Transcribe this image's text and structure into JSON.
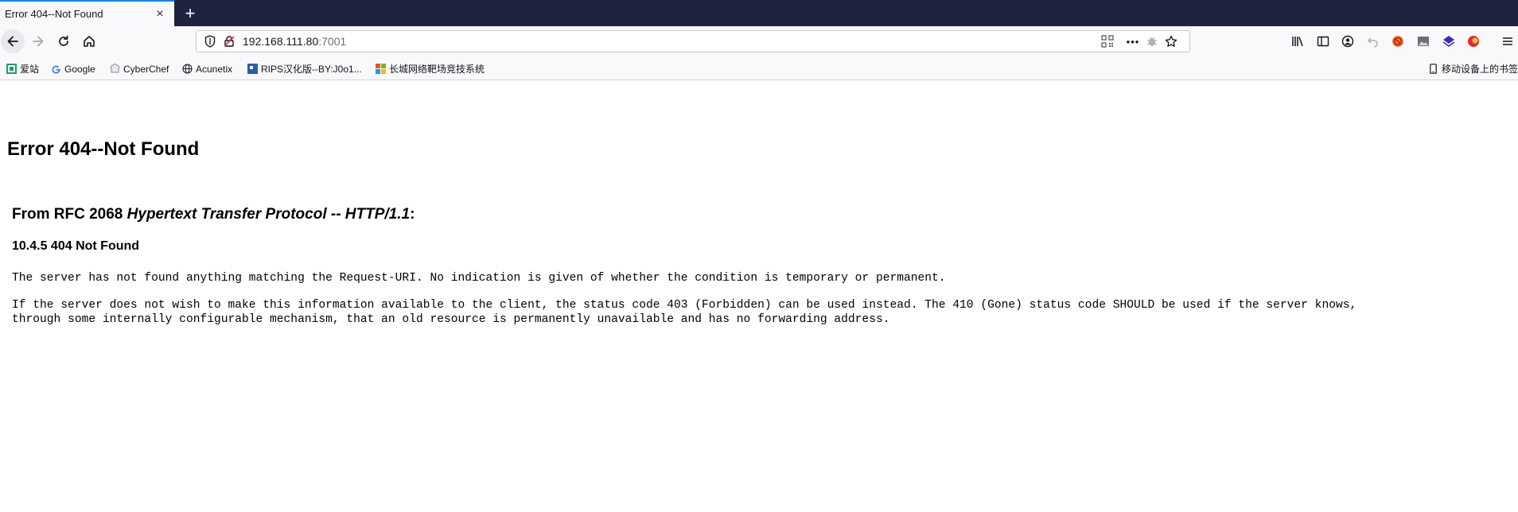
{
  "browser": {
    "tab_title": "Error 404--Not Found",
    "tab_close_symbol": "×",
    "new_tab_symbol": "+",
    "url_host": "192.168.111.80",
    "url_port": ":7001",
    "page_actions_symbol": "•••",
    "accent_color": "#0a84ff",
    "tabstrip_color": "#202340"
  },
  "bookmarks": [
    {
      "label": "爱站",
      "icon": "aizhan-icon"
    },
    {
      "label": "Google",
      "icon": "google-icon"
    },
    {
      "label": "CyberChef",
      "icon": "cyberchef-icon"
    },
    {
      "label": "Acunetix",
      "icon": "globe-icon"
    },
    {
      "label": "RIPS汉化版--BY:J0o1...",
      "icon": "rips-icon"
    },
    {
      "label": "长城网络靶场竞技系统",
      "icon": "windows-icon"
    }
  ],
  "mobile_bookmarks": "移动设备上的书签",
  "content": {
    "h1": "Error 404--Not Found",
    "h2_prefix": "From RFC 2068 ",
    "h2_italic": "Hypertext Transfer Protocol -- HTTP/1.1",
    "h2_suffix": ":",
    "h3": "10.4.5 404 Not Found",
    "p1": "The server has not found anything matching the Request-URI. No indication is given of whether the condition is temporary or permanent.",
    "p2_line1": "If the server does not wish to make this information available to the client, the status code 403 (Forbidden) can be used instead. The 410 (Gone) status code SHOULD be used if the server knows,",
    "p2_line2": "through some internally configurable mechanism, that an old resource is permanently unavailable and has no forwarding address."
  }
}
